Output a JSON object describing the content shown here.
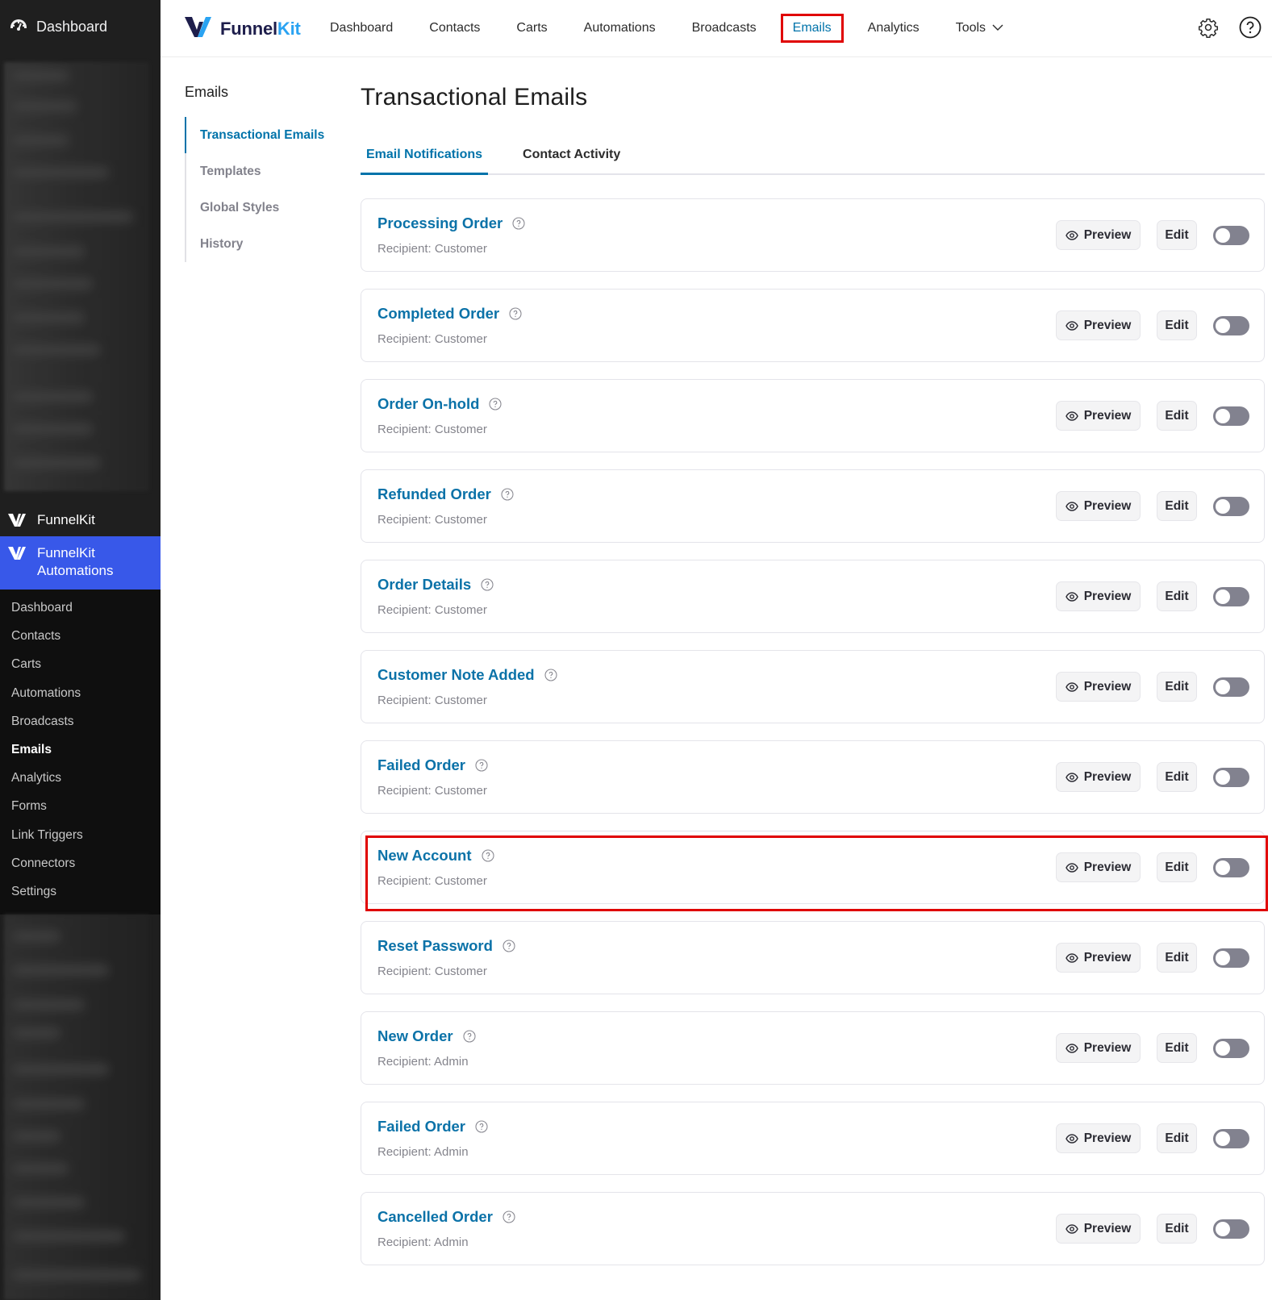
{
  "wp_sidebar": {
    "dashboard_label": "Dashboard",
    "funnelkit_label": "FunnelKit",
    "active_plugin_label_line1": "FunnelKit",
    "active_plugin_label_line2": "Automations",
    "submenu": [
      {
        "label": "Dashboard",
        "current": false
      },
      {
        "label": "Contacts",
        "current": false
      },
      {
        "label": "Carts",
        "current": false
      },
      {
        "label": "Automations",
        "current": false
      },
      {
        "label": "Broadcasts",
        "current": false
      },
      {
        "label": "Emails",
        "current": true
      },
      {
        "label": "Analytics",
        "current": false
      },
      {
        "label": "Forms",
        "current": false
      },
      {
        "label": "Link Triggers",
        "current": false
      },
      {
        "label": "Connectors",
        "current": false
      },
      {
        "label": "Settings",
        "current": false
      }
    ],
    "colors": {
      "background": "#1f1f1f",
      "active": "#3858e9"
    }
  },
  "header": {
    "brand_name_part1": "Funnel",
    "brand_name_part2": "Kit",
    "nav": [
      {
        "label": "Dashboard",
        "active": false
      },
      {
        "label": "Contacts",
        "active": false
      },
      {
        "label": "Carts",
        "active": false
      },
      {
        "label": "Automations",
        "active": false
      },
      {
        "label": "Broadcasts",
        "active": false
      },
      {
        "label": "Emails",
        "active": true
      },
      {
        "label": "Analytics",
        "active": false
      },
      {
        "label": "Tools",
        "active": false,
        "has_dropdown": true
      }
    ],
    "icons": [
      "gear-icon",
      "help-icon"
    ]
  },
  "subnav": {
    "title": "Emails",
    "items": [
      {
        "label": "Transactional Emails",
        "active": true
      },
      {
        "label": "Templates",
        "active": false
      },
      {
        "label": "Global Styles",
        "active": false
      },
      {
        "label": "History",
        "active": false
      }
    ]
  },
  "main": {
    "title": "Transactional Emails",
    "tabs": [
      {
        "label": "Email Notifications",
        "active": true
      },
      {
        "label": "Contact Activity",
        "active": false
      }
    ],
    "preview_label": "Preview",
    "edit_label": "Edit",
    "emails": [
      {
        "name": "Processing Order",
        "recipient": "Recipient: Customer",
        "enabled": false,
        "highlighted": false
      },
      {
        "name": "Completed Order",
        "recipient": "Recipient: Customer",
        "enabled": false,
        "highlighted": false
      },
      {
        "name": "Order On-hold",
        "recipient": "Recipient: Customer",
        "enabled": false,
        "highlighted": false
      },
      {
        "name": "Refunded Order",
        "recipient": "Recipient: Customer",
        "enabled": false,
        "highlighted": false
      },
      {
        "name": "Order Details",
        "recipient": "Recipient: Customer",
        "enabled": false,
        "highlighted": false
      },
      {
        "name": "Customer Note Added",
        "recipient": "Recipient: Customer",
        "enabled": false,
        "highlighted": false
      },
      {
        "name": "Failed Order",
        "recipient": "Recipient: Customer",
        "enabled": false,
        "highlighted": false
      },
      {
        "name": "New Account",
        "recipient": "Recipient: Customer",
        "enabled": false,
        "highlighted": true
      },
      {
        "name": "Reset Password",
        "recipient": "Recipient: Customer",
        "enabled": false,
        "highlighted": false
      },
      {
        "name": "New Order",
        "recipient": "Recipient: Admin",
        "enabled": false,
        "highlighted": false
      },
      {
        "name": "Failed Order",
        "recipient": "Recipient: Admin",
        "enabled": false,
        "highlighted": false
      },
      {
        "name": "Cancelled Order",
        "recipient": "Recipient: Admin",
        "enabled": false,
        "highlighted": false
      }
    ],
    "colors": {
      "link": "#0b72a8",
      "highlight_outline": "#e00000",
      "toggle_off": "#82828f"
    }
  }
}
